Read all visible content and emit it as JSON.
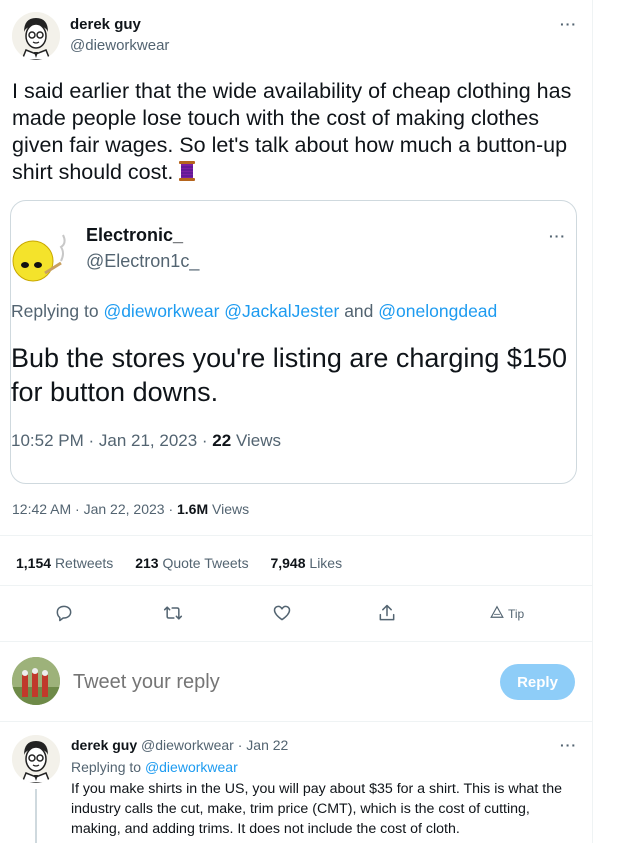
{
  "main_tweet": {
    "author_name": "derek guy",
    "author_handle": "@dieworkwear",
    "more_icon": "more-horizontal-icon",
    "text": "I said earlier that the wide availability of cheap clothing has made people lose touch with the cost of making clothes given fair wages. So let's talk about how much a button-up shirt should cost.",
    "emoji": "spool-of-thread",
    "timestamp": "12:42 AM · Jan 22, 2023 ·",
    "views_count": "1.6M",
    "views_label": "Views"
  },
  "quoted_tweet": {
    "author_name": "Electronic_",
    "author_handle": "@Electron1c_",
    "replying_to_prefix": "Replying to",
    "replying_to_handles": "@dieworkwear @JackalJester",
    "replying_to_and": "and",
    "replying_to_last": "@onelongdead",
    "text": "Bub the stores you're listing are charging $150 for button downs.",
    "timestamp": "10:52 PM · Jan 21, 2023 ·",
    "views_count": "22",
    "views_label": "Views"
  },
  "stats": {
    "retweets_count": "1,154",
    "retweets_label": "Retweets",
    "quotes_count": "213",
    "quotes_label": "Quote Tweets",
    "likes_count": "7,948",
    "likes_label": "Likes"
  },
  "actions": {
    "reply_icon": "reply-icon",
    "retweet_icon": "retweet-icon",
    "like_icon": "heart-icon",
    "share_icon": "share-icon",
    "tip_label": "Tip"
  },
  "reply_box": {
    "placeholder": "Tweet your reply",
    "button_label": "Reply"
  },
  "reply_tweet": {
    "author_name": "derek guy",
    "author_handle": "@dieworkwear",
    "date": "· Jan 22",
    "replying_to_prefix": "Replying to",
    "replying_to_handle": "@dieworkwear",
    "text": "If you make shirts in the US, you will pay about $35 for a shirt. This is what the industry calls the cut, make, trim price (CMT), which is the cost of cutting, making, and adding trims. It does not include the cost of cloth."
  },
  "colors": {
    "link": "#1d9bf0",
    "secondary_text": "#536471",
    "reply_button": "#8ecdf8"
  }
}
